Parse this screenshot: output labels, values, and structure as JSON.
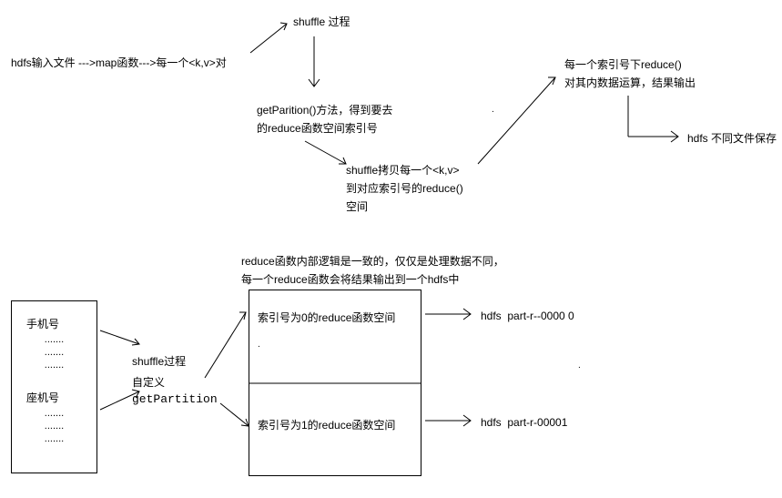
{
  "top": {
    "input": "hdfs输入文件 --->map函数--->每一个<k,v>对",
    "shuffle": "shuffle 过程",
    "partition_l1": "getParition()方法，得到要去",
    "partition_l2": "的reduce函数空间索引号",
    "copy_l1": "shuffle拷贝每一个<k,v>",
    "copy_l2": "到对应索引号的reduce()",
    "copy_l3": "空间",
    "reduce_l1": "每一个索引号下reduce()",
    "reduce_l2": "对其内数据运算，结果输出",
    "hdfs_out": "hdfs 不同文件保存"
  },
  "bottom": {
    "desc_l1": "reduce函数内部逻辑是一致的，仅仅是处理数据不同，",
    "desc_l2": "每一个reduce函数会将结果输出到一个hdfs中",
    "phone_label": "手机号",
    "landline_label": "座机号",
    "dots": ".......",
    "shuffle_custom_l1": "shuffle过程",
    "shuffle_custom_l2": "自定义",
    "getpartition": "getPartition",
    "reduce0": "索引号为0的reduce函数空间",
    "reduce1": "索引号为1的reduce函数空间",
    "out0": "hdfs  part-r--0000 0",
    "out1": "hdfs  part-r-00001"
  }
}
